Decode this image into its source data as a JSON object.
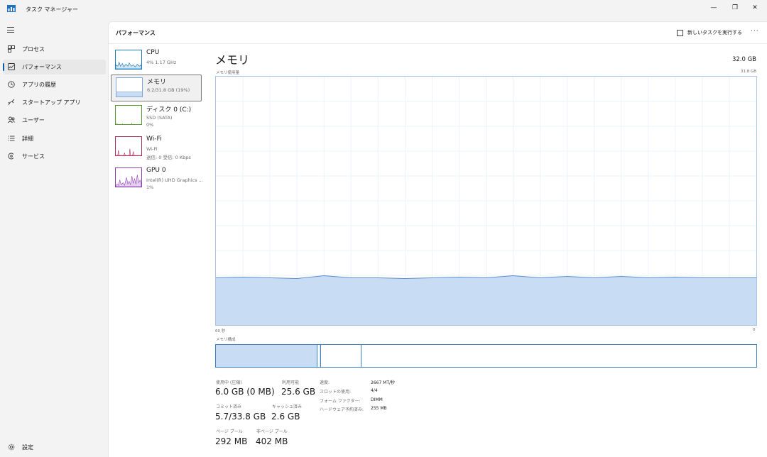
{
  "window": {
    "title": "タスク マネージャー",
    "controls": {
      "minimize": "—",
      "maximize": "❐",
      "close": "✕"
    }
  },
  "nav": {
    "items": [
      {
        "label": "プロセス",
        "icon": "processes-icon",
        "active": false
      },
      {
        "label": "パフォーマンス",
        "icon": "performance-icon",
        "active": true
      },
      {
        "label": "アプリの履歴",
        "icon": "history-icon",
        "active": false
      },
      {
        "label": "スタートアップ アプリ",
        "icon": "startup-icon",
        "active": false
      },
      {
        "label": "ユーザー",
        "icon": "users-icon",
        "active": false
      },
      {
        "label": "詳細",
        "icon": "details-icon",
        "active": false
      },
      {
        "label": "サービス",
        "icon": "services-icon",
        "active": false
      }
    ],
    "settings_label": "設定"
  },
  "header": {
    "title": "パフォーマンス",
    "run_task_label": "新しいタスクを実行する",
    "more_label": "···"
  },
  "resources": [
    {
      "name": "CPU",
      "sub1": "4%  1.17 GHz",
      "sub2": "",
      "color": "#1f7ab8"
    },
    {
      "name": "メモリ",
      "sub1": "6.2/31.8 GB (19%)",
      "sub2": "",
      "color": "#7aa7d8",
      "selected": true
    },
    {
      "name": "ディスク 0 (C:)",
      "sub1": "SSD (SATA)",
      "sub2": "0%",
      "color": "#5a9a2a"
    },
    {
      "name": "Wi-Fi",
      "sub1": "Wi-Fi",
      "sub2": "送信: 0  受信: 0 Kbps",
      "color": "#a8305a"
    },
    {
      "name": "GPU 0",
      "sub1": "Intel(R) UHD Graphics ...",
      "sub2": "1%",
      "color": "#8c3fb0"
    }
  ],
  "memory": {
    "title": "メモリ",
    "capacity": "32.0 GB",
    "graph_label": "メモリ使用量",
    "graph_max": "31.8 GB",
    "axis_left": "60 秒",
    "axis_right": "0",
    "composition_label": "メモリ構成",
    "usage_fraction": 0.19,
    "graph_color": "#c8dcf4",
    "graph_line_color": "#5b8fd0",
    "stats": {
      "in_use_label": "使用中 (圧縮)",
      "in_use_value": "6.0 GB (0 MB)",
      "available_label": "利用可能",
      "available_value": "25.6 GB",
      "committed_label": "コミット済み",
      "committed_value": "5.7/33.8 GB",
      "cached_label": "キャッシュ済み",
      "cached_value": "2.6 GB",
      "paged_label": "ページ プール",
      "paged_value": "292 MB",
      "nonpaged_label": "非ページ プール",
      "nonpaged_value": "402 MB"
    },
    "details": [
      {
        "key": "速度:",
        "value": "2667 MT/秒"
      },
      {
        "key": "スロットの使用:",
        "value": "4/4"
      },
      {
        "key": "フォーム ファクター:",
        "value": "DIMM"
      },
      {
        "key": "ハードウェア予約済み:",
        "value": "255 MB"
      }
    ]
  }
}
